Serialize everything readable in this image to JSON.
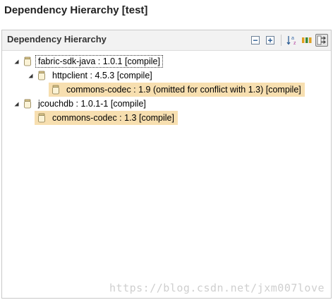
{
  "window": {
    "title": "Dependency Hierarchy [test]"
  },
  "panel": {
    "title": "Dependency Hierarchy",
    "toolbar": [
      {
        "name": "collapse-all-icon"
      },
      {
        "name": "expand-all-icon"
      },
      {
        "name": "sort-alphabetically-icon"
      },
      {
        "name": "show-columns-icon"
      },
      {
        "name": "show-conflicts-icon",
        "active": true
      }
    ]
  },
  "tree": {
    "items": [
      {
        "label": "fabric-sdk-java : 1.0.1 [compile]",
        "level": 0,
        "expanded": true,
        "selected": true
      },
      {
        "label": "httpclient : 4.5.3 [compile]",
        "level": 1,
        "expanded": true
      },
      {
        "label": "commons-codec : 1.9 (omitted for conflict with 1.3) [compile]",
        "level": 2,
        "highlighted": true
      },
      {
        "label": "jcouchdb : 1.0.1-1 [compile]",
        "level": 0,
        "expanded": true
      },
      {
        "label": "commons-codec : 1.3 [compile]",
        "level": 1,
        "highlighted": true
      }
    ]
  },
  "watermark": "https://blog.csdn.net/jxm007love",
  "colors": {
    "highlight": "#f7dfb0",
    "header_bg": "#f2f2f2",
    "border": "#c8c8c8"
  }
}
